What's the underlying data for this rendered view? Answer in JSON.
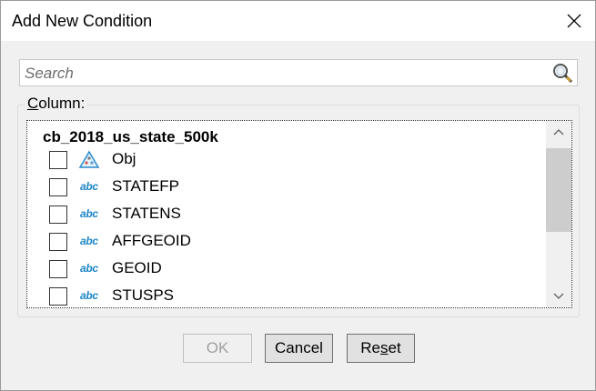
{
  "dialog": {
    "title": "Add New Condition",
    "close_icon": "close-icon"
  },
  "search": {
    "placeholder": "Search",
    "value": "",
    "icon": "magnifier-icon"
  },
  "column_group": {
    "label_prefix": "C",
    "label_rest": "olumn:"
  },
  "list": {
    "header": "cb_2018_us_state_500k",
    "items": [
      {
        "label": "Obj",
        "icon": "geometry-icon",
        "checked": false
      },
      {
        "label": "STATEFP",
        "icon": "abc",
        "checked": false
      },
      {
        "label": "STATENS",
        "icon": "abc",
        "checked": false
      },
      {
        "label": "AFFGEOID",
        "icon": "abc",
        "checked": false
      },
      {
        "label": "GEOID",
        "icon": "abc",
        "checked": false
      },
      {
        "label": "STUSPS",
        "icon": "abc",
        "checked": false
      }
    ]
  },
  "buttons": {
    "ok": "OK",
    "cancel": "Cancel",
    "reset_prefix": "Re",
    "reset_underlined": "s",
    "reset_suffix": "et"
  },
  "colors": {
    "text_type_icon": "#1f86c9",
    "disabled_text": "#a0a0a0"
  }
}
